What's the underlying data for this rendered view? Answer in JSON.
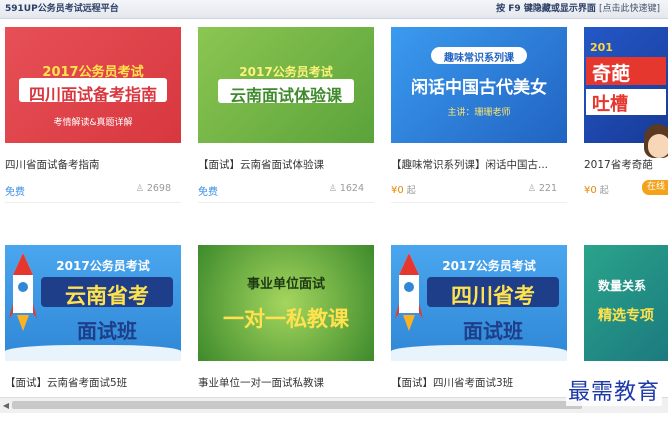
{
  "topbar": {
    "title": "591UP公务员考试远程平台",
    "hint": "按 F9 键隐藏或显示界面",
    "hint_sub": "[点击此快速键]"
  },
  "colors": {
    "red": "#e0424a",
    "green": "#7ab844",
    "blue": "#2f80d8",
    "price_orange": "#e8870b",
    "free_blue": "#3a8ee6"
  },
  "cards": [
    {
      "thumb_top": "2017公务员考试",
      "thumb_main": "四川面试备考指南",
      "thumb_sub": "考情解读&真题详解",
      "title": "四川省面试备考指南",
      "price": "免费",
      "count": "2698"
    },
    {
      "thumb_top": "2017公务员考试",
      "thumb_main": "云南面试体验课",
      "title": "【面试】云南省面试体验课",
      "price": "免费",
      "count": "1624"
    },
    {
      "thumb_top": "趣味常识系列课",
      "thumb_main": "闲话中国古代美女",
      "thumb_sub": "主讲：珊珊老师",
      "title": "【趣味常识系列课】闲话中国古...",
      "price": "¥0",
      "price_suffix": "起",
      "count": "221"
    },
    {
      "thumb_top": "201",
      "thumb_main": "奇葩",
      "thumb_sub": "吐槽",
      "title": "2017省考奇葩",
      "price": "¥0",
      "price_suffix": "起",
      "badge": "在线"
    },
    {
      "thumb_top": "2017公务员考试",
      "thumb_main": "云南省考",
      "thumb_sub": "面试班",
      "title": "【面试】云南省考面试5班"
    },
    {
      "thumb_main": "事业单位面试",
      "thumb_sub": "一对一私教课",
      "title": "事业单位一对一面试私教课"
    },
    {
      "thumb_top": "2017公务员考试",
      "thumb_main": "四川省考",
      "thumb_sub": "面试班",
      "title": "【面试】四川省考面试3班"
    },
    {
      "thumb_main": "数量关系",
      "thumb_sub": "精选专项"
    }
  ],
  "watermark": "最需教育"
}
